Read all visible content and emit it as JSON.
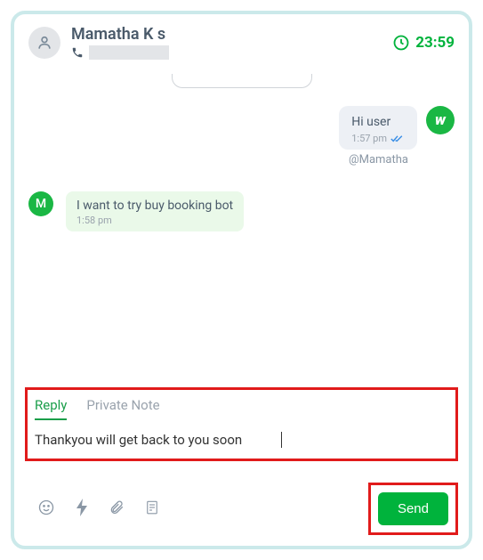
{
  "header": {
    "contact_name": "Mamatha K s",
    "timer": "23:59"
  },
  "messages": {
    "out1": {
      "text": "Hi user",
      "time": "1:57 pm",
      "sender": "@Mamatha"
    },
    "in1": {
      "avatar_letter": "M",
      "text": "I want to try buy booking bot",
      "time": "1:58 pm"
    }
  },
  "compose": {
    "tab_reply": "Reply",
    "tab_private": "Private Note",
    "input_value": "Thankyou will get back to you soon",
    "send_label": "Send"
  },
  "colors": {
    "accent": "#00b33c",
    "highlight": "#e11b1b"
  }
}
